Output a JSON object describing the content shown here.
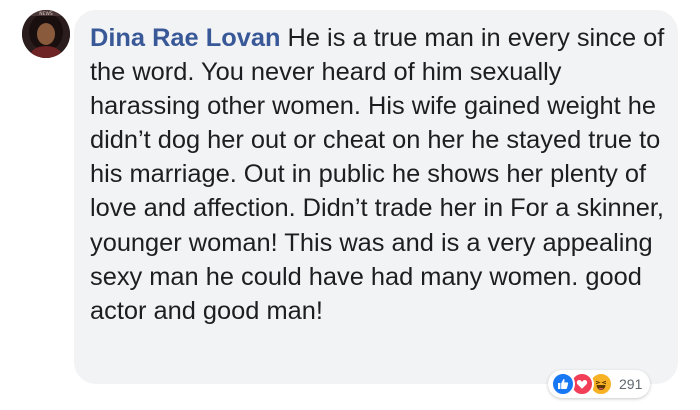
{
  "comment": {
    "author": "Dina Rae Lovan",
    "text": "He is a true man in every since of the word. You never heard of him sexually harassing other women. His wife gained weight he didn’t dog her out or cheat on her he stayed true to his marriage. Out in public he shows her plenty of love and affection. Didn’t trade her in For a skinner, younger woman! This was and is a very appealing sexy man he could have had many women. good actor and good man!",
    "reactions": {
      "icons": [
        "like-icon",
        "love-icon",
        "haha-icon"
      ],
      "count": "291"
    }
  },
  "colors": {
    "author": "#385898",
    "text": "#1c1e21",
    "bubble": "#f2f3f5",
    "like": "#1877f2",
    "love": "#f33e58",
    "haha": "#f7b125",
    "count": "#606770"
  }
}
